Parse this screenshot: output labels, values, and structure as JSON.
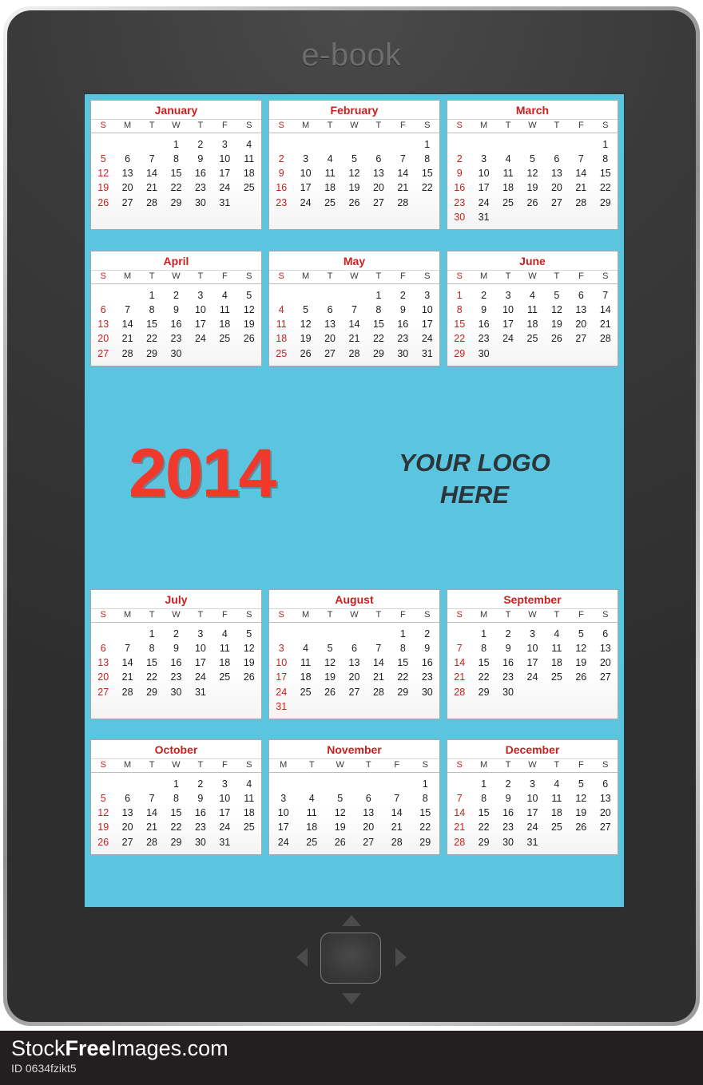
{
  "device": {
    "brand_label": "e-book",
    "nav": {
      "up_icon": "triangle-up-icon",
      "down_icon": "triangle-down-icon",
      "left_icon": "triangle-left-icon",
      "right_icon": "triangle-right-icon",
      "center_label": ""
    }
  },
  "screen": {
    "background_color": "#5bc5e0",
    "year": "2014",
    "logo_line1": "YOUR LOGO",
    "logo_line2": "HERE",
    "accent_red": "#c8201f",
    "year_red": "#f0392b"
  },
  "calendar": {
    "year": "2014",
    "weekdays": [
      "S",
      "M",
      "T",
      "W",
      "T",
      "F",
      "S"
    ],
    "months": [
      {
        "name": "January",
        "weekdays": [
          "S",
          "M",
          "T",
          "W",
          "T",
          "F",
          "S"
        ],
        "weeks": [
          [
            "",
            "",
            "",
            "1",
            "2",
            "3",
            "4"
          ],
          [
            "5",
            "6",
            "7",
            "8",
            "9",
            "10",
            "11"
          ],
          [
            "12",
            "13",
            "14",
            "15",
            "16",
            "17",
            "18"
          ],
          [
            "19",
            "20",
            "21",
            "22",
            "23",
            "24",
            "25"
          ],
          [
            "26",
            "27",
            "28",
            "29",
            "30",
            "31",
            ""
          ]
        ]
      },
      {
        "name": "February",
        "weekdays": [
          "S",
          "M",
          "T",
          "W",
          "T",
          "F",
          "S"
        ],
        "weeks": [
          [
            "",
            "",
            "",
            "",
            "",
            "",
            "1"
          ],
          [
            "2",
            "3",
            "4",
            "5",
            "6",
            "7",
            "8"
          ],
          [
            "9",
            "10",
            "11",
            "12",
            "13",
            "14",
            "15"
          ],
          [
            "16",
            "17",
            "18",
            "19",
            "20",
            "21",
            "22"
          ],
          [
            "23",
            "24",
            "25",
            "26",
            "27",
            "28",
            ""
          ]
        ]
      },
      {
        "name": "March",
        "weekdays": [
          "S",
          "M",
          "T",
          "W",
          "T",
          "F",
          "S"
        ],
        "weeks": [
          [
            "",
            "",
            "",
            "",
            "",
            "",
            "1"
          ],
          [
            "2",
            "3",
            "4",
            "5",
            "6",
            "7",
            "8"
          ],
          [
            "9",
            "10",
            "11",
            "12",
            "13",
            "14",
            "15"
          ],
          [
            "16",
            "17",
            "18",
            "19",
            "20",
            "21",
            "22"
          ],
          [
            "23",
            "24",
            "25",
            "26",
            "27",
            "28",
            "29"
          ],
          [
            "30",
            "31",
            "",
            "",
            "",
            "",
            ""
          ]
        ]
      },
      {
        "name": "April",
        "weekdays": [
          "S",
          "M",
          "T",
          "W",
          "T",
          "F",
          "S"
        ],
        "weeks": [
          [
            "",
            "",
            "1",
            "2",
            "3",
            "4",
            "5"
          ],
          [
            "6",
            "7",
            "8",
            "9",
            "10",
            "11",
            "12"
          ],
          [
            "13",
            "14",
            "15",
            "16",
            "17",
            "18",
            "19"
          ],
          [
            "20",
            "21",
            "22",
            "23",
            "24",
            "25",
            "26"
          ],
          [
            "27",
            "28",
            "29",
            "30",
            "",
            "",
            ""
          ]
        ]
      },
      {
        "name": "May",
        "weekdays": [
          "S",
          "M",
          "T",
          "W",
          "T",
          "F",
          "S"
        ],
        "weeks": [
          [
            "",
            "",
            "",
            "",
            "1",
            "2",
            "3"
          ],
          [
            "4",
            "5",
            "6",
            "7",
            "8",
            "9",
            "10"
          ],
          [
            "11",
            "12",
            "13",
            "14",
            "15",
            "16",
            "17"
          ],
          [
            "18",
            "19",
            "20",
            "21",
            "22",
            "23",
            "24"
          ],
          [
            "25",
            "26",
            "27",
            "28",
            "29",
            "30",
            "31"
          ]
        ]
      },
      {
        "name": "June",
        "weekdays": [
          "S",
          "M",
          "T",
          "W",
          "T",
          "F",
          "S"
        ],
        "weeks": [
          [
            "1",
            "2",
            "3",
            "4",
            "5",
            "6",
            "7"
          ],
          [
            "8",
            "9",
            "10",
            "11",
            "12",
            "13",
            "14"
          ],
          [
            "15",
            "16",
            "17",
            "18",
            "19",
            "20",
            "21"
          ],
          [
            "22",
            "23",
            "24",
            "25",
            "26",
            "27",
            "28"
          ],
          [
            "29",
            "30",
            "",
            "",
            "",
            "",
            ""
          ]
        ]
      },
      {
        "name": "July",
        "weekdays": [
          "S",
          "M",
          "T",
          "W",
          "T",
          "F",
          "S"
        ],
        "weeks": [
          [
            "",
            "",
            "1",
            "2",
            "3",
            "4",
            "5"
          ],
          [
            "6",
            "7",
            "8",
            "9",
            "10",
            "11",
            "12"
          ],
          [
            "13",
            "14",
            "15",
            "16",
            "17",
            "18",
            "19"
          ],
          [
            "20",
            "21",
            "22",
            "23",
            "24",
            "25",
            "26"
          ],
          [
            "27",
            "28",
            "29",
            "30",
            "31",
            "",
            ""
          ]
        ]
      },
      {
        "name": "August",
        "weekdays": [
          "S",
          "M",
          "T",
          "W",
          "T",
          "F",
          "S"
        ],
        "weeks": [
          [
            "",
            "",
            "",
            "",
            "",
            "1",
            "2"
          ],
          [
            "3",
            "4",
            "5",
            "6",
            "7",
            "8",
            "9"
          ],
          [
            "10",
            "11",
            "12",
            "13",
            "14",
            "15",
            "16"
          ],
          [
            "17",
            "18",
            "19",
            "20",
            "21",
            "22",
            "23"
          ],
          [
            "24",
            "25",
            "26",
            "27",
            "28",
            "29",
            "30"
          ],
          [
            "31",
            "",
            "",
            "",
            "",
            "",
            ""
          ]
        ]
      },
      {
        "name": "September",
        "weekdays": [
          "S",
          "M",
          "T",
          "W",
          "T",
          "F",
          "S"
        ],
        "weeks": [
          [
            "",
            "1",
            "2",
            "3",
            "4",
            "5",
            "6"
          ],
          [
            "7",
            "8",
            "9",
            "10",
            "11",
            "12",
            "13"
          ],
          [
            "14",
            "15",
            "16",
            "17",
            "18",
            "19",
            "20"
          ],
          [
            "21",
            "22",
            "23",
            "24",
            "25",
            "26",
            "27"
          ],
          [
            "28",
            "29",
            "30",
            "",
            "",
            "",
            ""
          ]
        ]
      },
      {
        "name": "October",
        "weekdays": [
          "S",
          "M",
          "T",
          "W",
          "T",
          "F",
          "S"
        ],
        "weeks": [
          [
            "",
            "",
            "",
            "1",
            "2",
            "3",
            "4"
          ],
          [
            "5",
            "6",
            "7",
            "8",
            "9",
            "10",
            "11"
          ],
          [
            "12",
            "13",
            "14",
            "15",
            "16",
            "17",
            "18"
          ],
          [
            "19",
            "20",
            "21",
            "22",
            "23",
            "24",
            "25"
          ],
          [
            "26",
            "27",
            "28",
            "29",
            "30",
            "31",
            ""
          ]
        ]
      },
      {
        "name": "November",
        "weekdays": [
          "M",
          "T",
          "W",
          "T",
          "F",
          "S"
        ],
        "weeks": [
          [
            "",
            "",
            "",
            "",
            "",
            "1"
          ],
          [
            "3",
            "4",
            "5",
            "6",
            "7",
            "8"
          ],
          [
            "10",
            "11",
            "12",
            "13",
            "14",
            "15"
          ],
          [
            "17",
            "18",
            "19",
            "20",
            "21",
            "22"
          ],
          [
            "24",
            "25",
            "26",
            "27",
            "28",
            "29"
          ]
        ]
      },
      {
        "name": "December",
        "weekdays": [
          "S",
          "M",
          "T",
          "W",
          "T",
          "F",
          "S"
        ],
        "weeks": [
          [
            "",
            "1",
            "2",
            "3",
            "4",
            "5",
            "6"
          ],
          [
            "7",
            "8",
            "9",
            "10",
            "11",
            "12",
            "13"
          ],
          [
            "14",
            "15",
            "16",
            "17",
            "18",
            "19",
            "20"
          ],
          [
            "21",
            "22",
            "23",
            "24",
            "25",
            "26",
            "27"
          ],
          [
            "28",
            "29",
            "30",
            "31",
            "",
            "",
            ""
          ]
        ]
      }
    ]
  },
  "watermark": {
    "title_prefix": "Stock",
    "title_bold": "Free",
    "title_suffix": "Images.com",
    "id_label": "ID 0634fzikt5"
  }
}
